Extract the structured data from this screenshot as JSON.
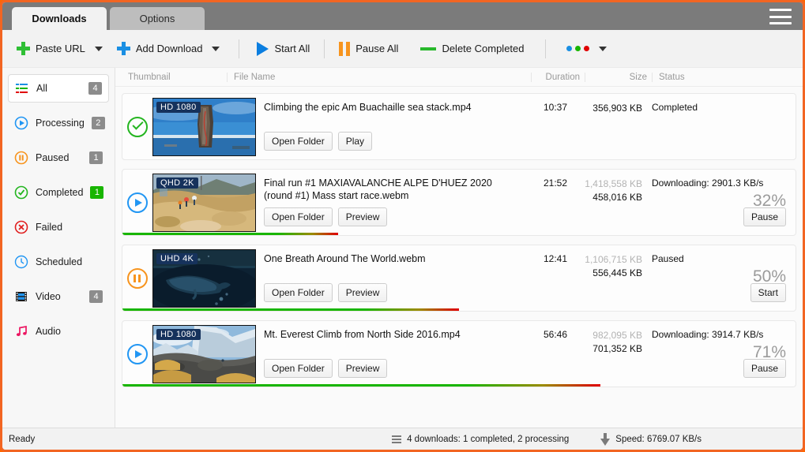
{
  "window": {
    "tabs": [
      {
        "label": "Downloads",
        "active": true
      },
      {
        "label": "Options",
        "active": false
      }
    ],
    "menu_icon": "hamburger-icon"
  },
  "toolbar": {
    "paste_url": "Paste URL",
    "add_download": "Add Download",
    "start_all": "Start All",
    "pause_all": "Pause All",
    "delete_completed": "Delete Completed",
    "more_dots": [
      "#1a8fe3",
      "#18b500",
      "#e00000"
    ]
  },
  "sidebar": {
    "items": [
      {
        "label": "All",
        "icon": "list-lines-icon",
        "badge": "4",
        "badge_style": "gray",
        "active": true
      },
      {
        "label": "Processing",
        "icon": "play-circle-icon",
        "badge": "2",
        "badge_style": "gray",
        "active": false
      },
      {
        "label": "Paused",
        "icon": "pause-circle-icon",
        "badge": "1",
        "badge_style": "gray",
        "active": false
      },
      {
        "label": "Completed",
        "icon": "check-circle-icon",
        "badge": "1",
        "badge_style": "green",
        "active": false
      },
      {
        "label": "Failed",
        "icon": "error-circle-icon",
        "badge": "",
        "badge_style": "none",
        "active": false
      },
      {
        "label": "Scheduled",
        "icon": "clock-icon",
        "badge": "",
        "badge_style": "none",
        "active": false
      },
      {
        "label": "Video",
        "icon": "film-icon",
        "badge": "4",
        "badge_style": "gray",
        "active": false
      },
      {
        "label": "Audio",
        "icon": "music-note-icon",
        "badge": "",
        "badge_style": "none",
        "active": false
      }
    ]
  },
  "columns": {
    "thumbnail": "Thumbnail",
    "file_name": "File Name",
    "duration": "Duration",
    "size": "Size",
    "status": "Status"
  },
  "downloads": [
    {
      "state_icon": "check-circle-icon",
      "quality": "HD 1080",
      "file_name": "Climbing the epic Am Buachaille sea stack.mp4",
      "buttons": [
        "Open Folder",
        "Play"
      ],
      "duration": "10:37",
      "size_total": "356,903 KB",
      "size_done": "",
      "status": "Completed",
      "percent": "",
      "action_button": "",
      "progress": 100,
      "show_progress": false,
      "thumb": "sea-stack-thumbnail"
    },
    {
      "state_icon": "play-circle-icon",
      "quality": "QHD 2K",
      "file_name": "Final run #1  MAXIAVALANCHE ALPE D'HUEZ 2020 (round #1) Mass start race.webm",
      "buttons": [
        "Open Folder",
        "Preview"
      ],
      "duration": "21:52",
      "size_total": "1,418,558 KB",
      "size_done": "458,016 KB",
      "status": "Downloading: 2901.3 KB/s",
      "percent": "32%",
      "action_button": "Pause",
      "progress": 32,
      "show_progress": true,
      "thumb": "mountain-bike-thumbnail"
    },
    {
      "state_icon": "pause-circle-icon",
      "quality": "UHD 4K",
      "file_name": "One Breath Around The World.webm",
      "buttons": [
        "Open Folder",
        "Preview"
      ],
      "duration": "12:41",
      "size_total": "1,106,715 KB",
      "size_done": "556,445 KB",
      "status": "Paused",
      "percent": "50%",
      "action_button": "Start",
      "progress": 50,
      "show_progress": true,
      "thumb": "whale-underwater-thumbnail"
    },
    {
      "state_icon": "play-circle-icon",
      "quality": "HD 1080",
      "file_name": "Mt. Everest Climb from North Side 2016.mp4",
      "buttons": [
        "Open Folder",
        "Preview"
      ],
      "duration": "56:46",
      "size_total": "982,095 KB",
      "size_done": "701,352 KB",
      "status": "Downloading: 3914.7 KB/s",
      "percent": "71%",
      "action_button": "Pause",
      "progress": 71,
      "show_progress": true,
      "thumb": "everest-camp-thumbnail"
    }
  ],
  "statusbar": {
    "ready": "Ready",
    "downloads_summary": "4 downloads: 1 completed, 2 processing",
    "speed": "Speed: 6769.07 KB/s"
  }
}
